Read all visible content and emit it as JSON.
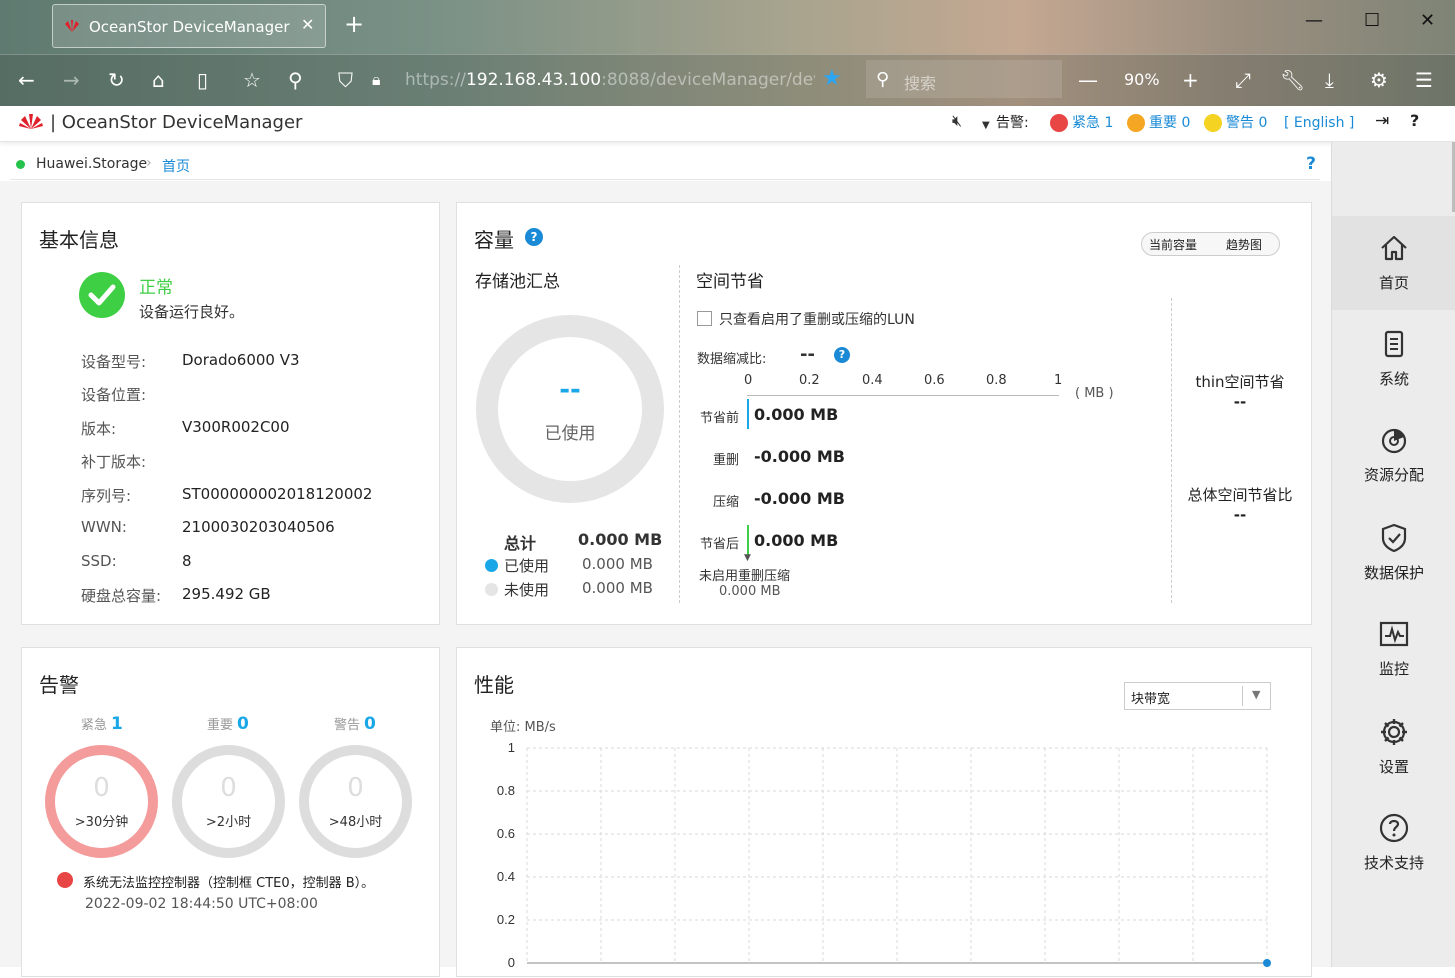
{
  "browser": {
    "tab_title": "OceanStor DeviceManager",
    "url_scheme": "https://",
    "url_host": "192.168.43.100",
    "url_rest": ":8088/deviceManager/dev",
    "search_placeholder": "搜索",
    "zoom": "90%"
  },
  "header": {
    "app_title": "OceanStor DeviceManager",
    "alarm_label": "告警:",
    "critical": "紧急 1",
    "major": "重要 0",
    "warning": "警告 0",
    "language": "[ English ]",
    "colors": {
      "critical": "#e84545",
      "major": "#f5a623",
      "warning": "#f5d323",
      "link": "#1a8ad6"
    }
  },
  "breadcrumb": {
    "root": "Huawei.Storage",
    "current": "首页",
    "help": "?"
  },
  "basic_info": {
    "title": "基本信息",
    "status": "正常",
    "status_desc": "设备运行良好。",
    "rows": [
      {
        "k": "设备型号:",
        "v": "Dorado6000 V3"
      },
      {
        "k": "设备位置:",
        "v": ""
      },
      {
        "k": "版本:",
        "v": "V300R002C00"
      },
      {
        "k": "补丁版本:",
        "v": ""
      },
      {
        "k": "序列号:",
        "v": "ST000000002018120002"
      },
      {
        "k": "WWN:",
        "v": "2100030203040506"
      },
      {
        "k": "SSD:",
        "v": "8"
      },
      {
        "k": "硬盘总容量:",
        "v": "295.492 GB"
      }
    ]
  },
  "capacity": {
    "title": "容量",
    "toggle": [
      "当前容量",
      "趋势图"
    ],
    "pool_title": "存储池汇总",
    "ring_value": "--",
    "ring_label": "已使用",
    "total_label": "总计",
    "total_value": "0.000 MB",
    "used_label": "已使用",
    "used_value": "0.000 MB",
    "unused_label": "未使用",
    "unused_value": "0.000 MB",
    "savings_title": "空间节省",
    "checkbox_label": "只查看启用了重删或压缩的LUN",
    "ratio_label": "数据缩减比:",
    "ratio_value": "--",
    "ticks": [
      "0",
      "0.2",
      "0.4",
      "0.6",
      "0.8",
      "1"
    ],
    "unit": "( MB )",
    "bars": [
      {
        "label": "节省前",
        "value": "0.000 MB"
      },
      {
        "label": "重删",
        "value": "-0.000 MB"
      },
      {
        "label": "压缩",
        "value": "-0.000 MB"
      },
      {
        "label": "节省后",
        "value": "0.000 MB"
      }
    ],
    "not_enabled_label": "未启用重删压缩",
    "not_enabled_value": "0.000 MB",
    "thin_label": "thin空间节省",
    "thin_value": "--",
    "overall_label": "总体空间节省比",
    "overall_value": "--"
  },
  "alarms": {
    "title": "告警",
    "levels": [
      {
        "name": "紧急",
        "count": "1",
        "ring_count": "0",
        "desc": ">30分钟"
      },
      {
        "name": "重要",
        "count": "0",
        "ring_count": "0",
        "desc": ">2小时"
      },
      {
        "name": "警告",
        "count": "0",
        "ring_count": "0",
        "desc": ">48小时"
      }
    ],
    "message": "系统无法监控控制器（控制框 CTE0，控制器 B）。",
    "time": "2022-09-02 18:44:50 UTC+08:00"
  },
  "performance": {
    "title": "性能",
    "select": "块带宽",
    "unit": "单位:  MB/s"
  },
  "chart_data": {
    "type": "line",
    "title": "",
    "ylabel": "MB/s",
    "ylim": [
      0,
      1
    ],
    "yticks": [
      "1",
      "0.8",
      "0.6",
      "0.4",
      "0.2",
      "0"
    ],
    "series": [
      {
        "values": [
          0
        ]
      }
    ],
    "grid": true
  },
  "nav": [
    {
      "label": "首页",
      "icon": "home-icon",
      "active": true
    },
    {
      "label": "系统",
      "icon": "system-icon",
      "active": false
    },
    {
      "label": "资源分配",
      "icon": "resource-icon",
      "active": false
    },
    {
      "label": "数据保护",
      "icon": "shield-icon",
      "active": false
    },
    {
      "label": "监控",
      "icon": "monitor-icon",
      "active": false
    },
    {
      "label": "设置",
      "icon": "gear-icon",
      "active": false
    },
    {
      "label": "技术支持",
      "icon": "support-icon",
      "active": false
    }
  ]
}
